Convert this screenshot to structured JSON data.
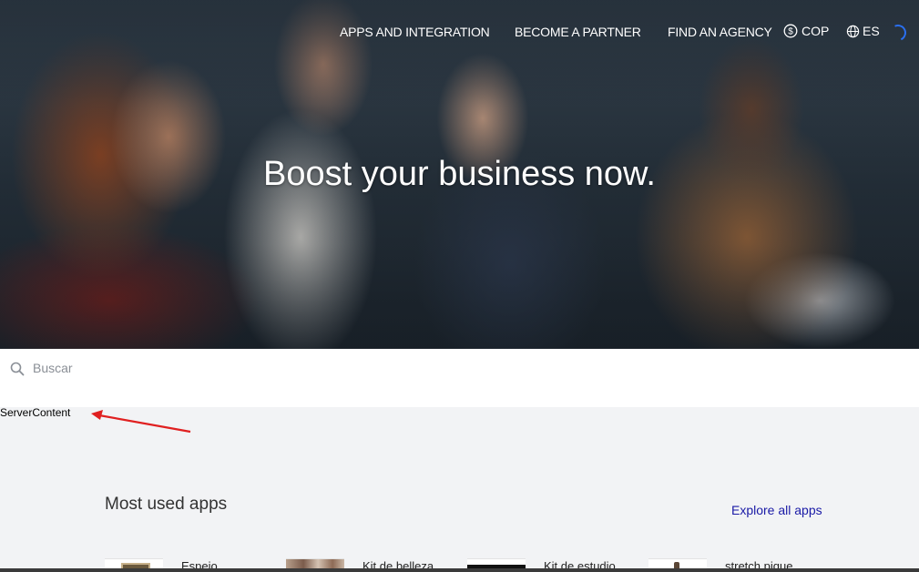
{
  "nav": {
    "apps": "APPS AND INTEGRATION",
    "partner": "BECOME A PARTNER",
    "agency": "FIND AN AGENCY",
    "currency": "COP",
    "language": "ES"
  },
  "hero": {
    "title": "Boost your business now."
  },
  "search": {
    "placeholder": "Buscar",
    "value": ""
  },
  "debug": {
    "server_content": "ServerContent",
    "arrow_color": "#e02020"
  },
  "most_used": {
    "title": "Most used apps",
    "explore": "Explore all apps",
    "apps": [
      {
        "name": "Espejo"
      },
      {
        "name": "Kit de belleza"
      },
      {
        "name": "Kit de estudio"
      },
      {
        "name": "stretch pique"
      }
    ]
  },
  "colors": {
    "link": "#1a1aa6",
    "spinner": "#2a6ff0",
    "background": "#f2f3f5"
  }
}
